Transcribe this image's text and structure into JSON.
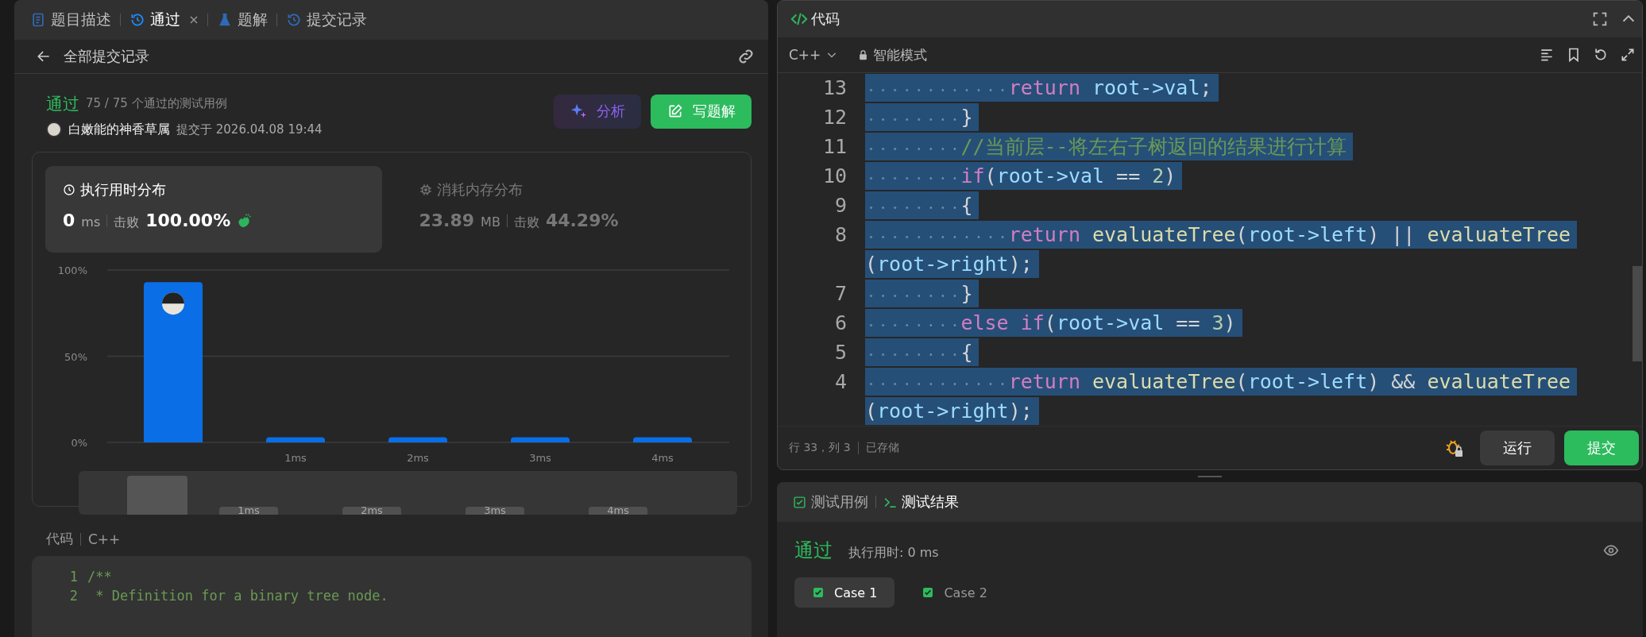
{
  "problem_tabs": [
    {
      "label": "题目描述",
      "selected": false,
      "closable": false
    },
    {
      "label": "通过",
      "selected": true,
      "closable": true
    },
    {
      "label": "题解",
      "selected": false,
      "closable": false
    },
    {
      "label": "提交记录",
      "selected": false,
      "closable": false
    }
  ],
  "submission_header": {
    "back_label": "全部提交记录"
  },
  "result": {
    "status": "通过",
    "cases_passed": "75 / 75 个通过的测试用例",
    "user": "白嫩能的神香草属",
    "submitted": "提交于 2026.04.08 19:44",
    "buttons": [
      {
        "label": "分析",
        "kind": "ai"
      },
      {
        "label": "写题解",
        "kind": "primary"
      }
    ]
  },
  "stats": [
    {
      "title": "执行用时分布",
      "value": "0",
      "unit": "ms",
      "beats_label": "击败",
      "beats": "100.00%",
      "selected": true,
      "celebrate": true
    },
    {
      "title": "消耗内存分布",
      "value": "23.89",
      "unit": "MB",
      "beats_label": "击败",
      "beats": "44.29%",
      "selected": false,
      "celebrate": false
    }
  ],
  "chart_data": {
    "type": "bar",
    "categories": [
      null,
      "1ms",
      "2ms",
      "3ms",
      "4ms"
    ],
    "values": [
      93,
      3,
      3,
      3,
      3
    ],
    "ylim": [
      0,
      100
    ],
    "yticks": [
      {
        "value": 0,
        "label": "0%"
      },
      {
        "value": 50,
        "label": "50%"
      },
      {
        "value": 100,
        "label": "100%"
      }
    ]
  },
  "navigator_labels": [
    "1ms",
    "2ms",
    "3ms",
    "4ms"
  ],
  "submitted_code": {
    "title": "代码",
    "language": "C++",
    "lines": [
      {
        "number": "1",
        "text": "/**"
      },
      {
        "number": "2",
        "text": " * Definition for a binary tree node."
      }
    ]
  },
  "editor": {
    "title": "代码",
    "language": "C++",
    "mode": "智能模式",
    "lines": [
      {
        "number": "13",
        "selected": true,
        "tokens": [
          {
            "kind": "keyword",
            "text": "            return"
          },
          {
            "kind": "identifier",
            "text": " root->val"
          },
          {
            "kind": "punctuation",
            "text": ";"
          }
        ]
      },
      {
        "number": "12",
        "selected": true,
        "tokens": [
          {
            "kind": "punctuation",
            "text": "        }"
          }
        ]
      },
      {
        "number": "11",
        "selected": true,
        "tokens": [
          {
            "kind": "comment",
            "text": "        //当前层--将左右子树返回的结果进行计算"
          }
        ]
      },
      {
        "number": "10",
        "selected": true,
        "tokens": [
          {
            "kind": "keyword",
            "text": "        if"
          },
          {
            "kind": "punctuation",
            "text": "("
          },
          {
            "kind": "identifier",
            "text": "root->val"
          },
          {
            "kind": "punctuation",
            "text": " == "
          },
          {
            "kind": "number",
            "text": "2"
          },
          {
            "kind": "punctuation",
            "text": ")"
          }
        ]
      },
      {
        "number": "9",
        "selected": true,
        "tokens": [
          {
            "kind": "punctuation",
            "text": "        {"
          }
        ]
      },
      {
        "number": "8",
        "selected": true,
        "tokens": [
          {
            "kind": "keyword",
            "text": "            return"
          },
          {
            "kind": "function",
            "text": " evaluateTree"
          },
          {
            "kind": "punctuation",
            "text": "("
          },
          {
            "kind": "identifier",
            "text": "root->left"
          },
          {
            "kind": "punctuation",
            "text": ") || "
          },
          {
            "kind": "function",
            "text": "evaluateTree"
          }
        ],
        "wrap": [
          {
            "kind": "punctuation",
            "text": "("
          },
          {
            "kind": "identifier",
            "text": "root->right"
          },
          {
            "kind": "punctuation",
            "text": ");"
          }
        ]
      },
      {
        "number": "7",
        "selected": true,
        "tokens": [
          {
            "kind": "punctuation",
            "text": "        }"
          }
        ]
      },
      {
        "number": "6",
        "selected": true,
        "tokens": [
          {
            "kind": "keyword",
            "text": "        else if"
          },
          {
            "kind": "punctuation",
            "text": "("
          },
          {
            "kind": "identifier",
            "text": "root->val"
          },
          {
            "kind": "punctuation",
            "text": " == "
          },
          {
            "kind": "number",
            "text": "3"
          },
          {
            "kind": "punctuation",
            "text": ")"
          }
        ]
      },
      {
        "number": "5",
        "selected": true,
        "tokens": [
          {
            "kind": "punctuation",
            "text": "        {"
          }
        ]
      },
      {
        "number": "4",
        "selected": true,
        "tokens": [
          {
            "kind": "keyword",
            "text": "            return"
          },
          {
            "kind": "function",
            "text": " evaluateTree"
          },
          {
            "kind": "punctuation",
            "text": "("
          },
          {
            "kind": "identifier",
            "text": "root->left"
          },
          {
            "kind": "punctuation",
            "text": ") && "
          },
          {
            "kind": "function",
            "text": "evaluateTree"
          }
        ],
        "wrap": [
          {
            "kind": "punctuation",
            "text": "("
          },
          {
            "kind": "identifier",
            "text": "root->right"
          },
          {
            "kind": "punctuation",
            "text": ");"
          }
        ]
      }
    ],
    "status": {
      "position": "行 33，列 3",
      "saved": "已存储"
    },
    "buttons": [
      {
        "label": "运行",
        "kind": "secondary"
      },
      {
        "label": "提交",
        "kind": "primary"
      }
    ]
  },
  "test_panel": {
    "tabs": [
      {
        "label": "测试用例",
        "selected": false
      },
      {
        "label": "测试结果",
        "selected": true
      }
    ],
    "status": "通过",
    "runtime": "执行用时: 0 ms",
    "cases": [
      {
        "label": "Case 1",
        "selected": true,
        "passed": true
      },
      {
        "label": "Case 2",
        "selected": false,
        "passed": true
      }
    ]
  }
}
